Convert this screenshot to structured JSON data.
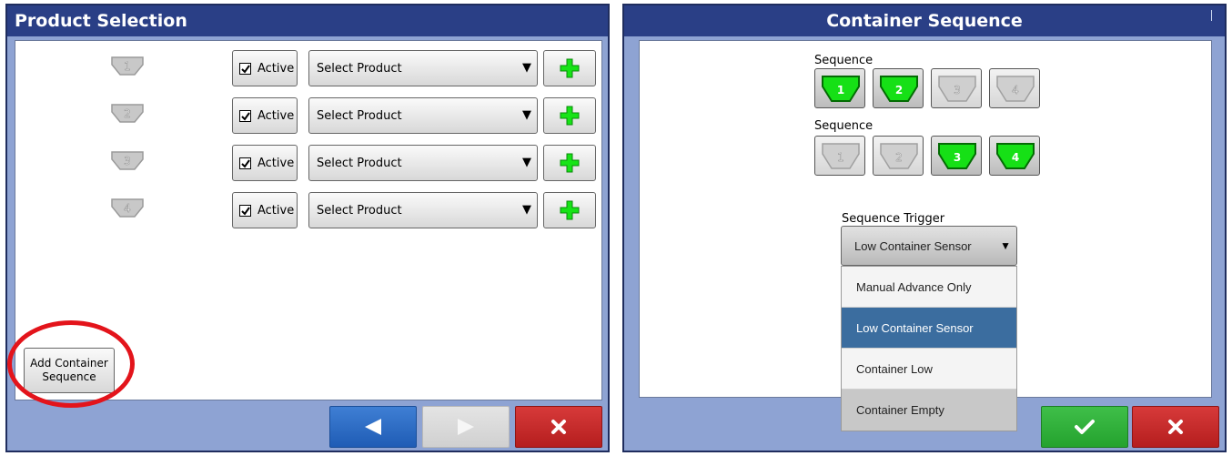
{
  "left": {
    "title": "Product Selection",
    "rows": [
      {
        "number": "1",
        "active_label": "Active",
        "product": "Select Product"
      },
      {
        "number": "2",
        "active_label": "Active",
        "product": "Select Product"
      },
      {
        "number": "3",
        "active_label": "Active",
        "product": "Select Product"
      },
      {
        "number": "4",
        "active_label": "Active",
        "product": "Select Product"
      }
    ],
    "add_sequence_line1": "Add Container",
    "add_sequence_line2": "Sequence"
  },
  "right": {
    "title": "Container Sequence",
    "sequence1": {
      "label": "Sequence",
      "buttons": [
        {
          "number": "1",
          "selected": true
        },
        {
          "number": "2",
          "selected": true
        },
        {
          "number": "3",
          "selected": false
        },
        {
          "number": "4",
          "selected": false
        }
      ]
    },
    "sequence2": {
      "label": "Sequence",
      "buttons": [
        {
          "number": "1",
          "selected": false
        },
        {
          "number": "2",
          "selected": false
        },
        {
          "number": "3",
          "selected": true
        },
        {
          "number": "4",
          "selected": true
        }
      ]
    },
    "trigger_label": "Sequence Trigger",
    "trigger_value": "Low Container Sensor",
    "options": [
      "Manual Advance Only",
      "Low Container Sensor",
      "Container Low",
      "Container Empty"
    ]
  },
  "colors": {
    "accent_green": "#17e317",
    "title_bar": "#2a3f86",
    "selected_option": "#3b6d9f",
    "highlight_ring": "#e3141b"
  }
}
